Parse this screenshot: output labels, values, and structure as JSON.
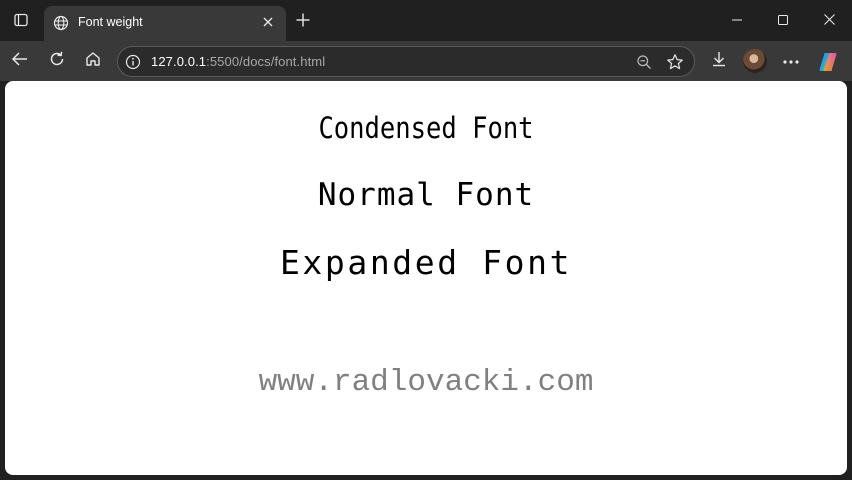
{
  "browser": {
    "tab": {
      "title": "Font weight",
      "favicon": "globe-icon"
    },
    "address_bar": {
      "host": "127.0.0.1",
      "path": ":5500/docs/font.html"
    },
    "icons": {
      "tab_actions": "tab-actions-icon",
      "close_tab": "close-icon",
      "new_tab": "plus-icon",
      "minimize": "minimize-icon",
      "maximize": "maximize-icon",
      "close_window": "close-icon",
      "back": "back-arrow-icon",
      "refresh": "refresh-icon",
      "home": "home-icon",
      "site_info": "info-icon",
      "zoom": "zoom-out-icon",
      "favorite": "star-icon",
      "downloads": "download-icon",
      "profile": "avatar",
      "more": "more-icon",
      "copilot": "copilot-icon"
    }
  },
  "page": {
    "condensed_text": "Condensed Font",
    "normal_text": "Normal Font",
    "expanded_text": "Expanded Font",
    "site_text": "www.radlovacki.com"
  },
  "colors": {
    "chrome_dark": "#202020",
    "toolbar": "#393939",
    "page_bg": "#ffffff",
    "text": "#000000",
    "site_text": "#808080"
  }
}
